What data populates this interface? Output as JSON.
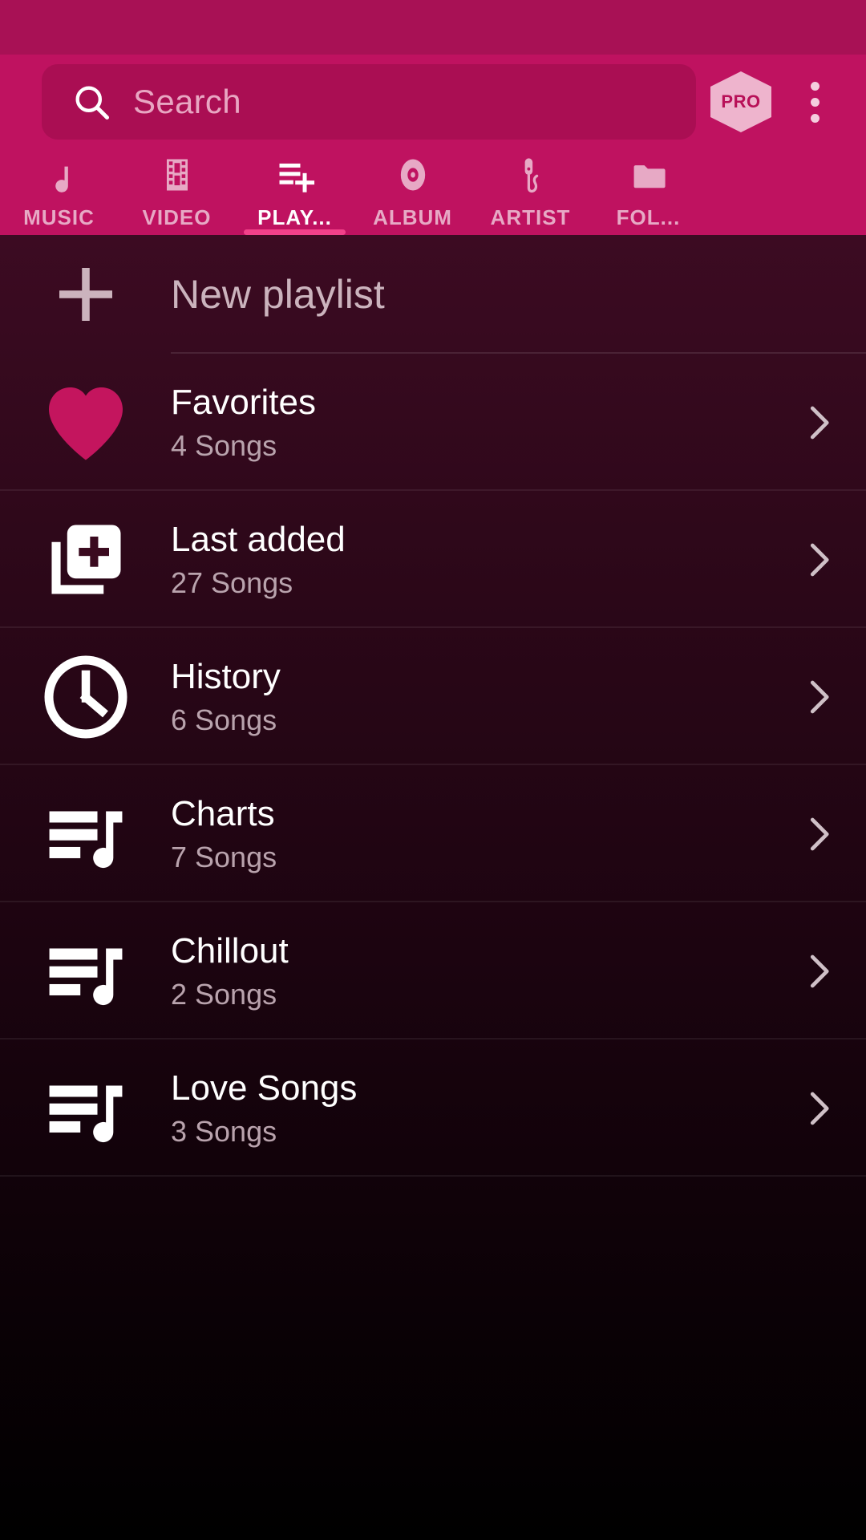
{
  "statusbar": {
    "color": "#a81155"
  },
  "appbar": {
    "color": "#bf1260",
    "search": {
      "placeholder": "Search",
      "value": "",
      "icon": "search-icon"
    },
    "pro_badge": {
      "label": "PRO",
      "hex_color": "#eeb4cd",
      "text_color": "#b81058"
    },
    "overflow": {
      "icon": "more-vertical-icon"
    }
  },
  "tabs": {
    "active_index": 2,
    "active_indicator_color": "#f2418a",
    "items": [
      {
        "label": "MUSIC",
        "icon": "music-note-icon"
      },
      {
        "label": "VIDEO",
        "icon": "film-strip-icon"
      },
      {
        "label": "PLAY...",
        "icon": "playlist-add-icon"
      },
      {
        "label": "ALBUM",
        "icon": "vinyl-disc-icon"
      },
      {
        "label": "ARTIST",
        "icon": "microphone-icon"
      },
      {
        "label": "FOL...",
        "icon": "folder-icon"
      }
    ]
  },
  "content": {
    "new_playlist": {
      "label": "New playlist",
      "icon": "plus-icon"
    },
    "playlists": [
      {
        "title": "Favorites",
        "subtitle": "4 Songs",
        "icon": "heart-icon",
        "icon_color": "#c4155e",
        "chevron": "chevron-right-icon"
      },
      {
        "title": "Last added",
        "subtitle": "27 Songs",
        "icon": "library-add-icon",
        "icon_color": "#ffffff",
        "chevron": "chevron-right-icon"
      },
      {
        "title": "History",
        "subtitle": "6 Songs",
        "icon": "clock-icon",
        "icon_color": "#ffffff",
        "chevron": "chevron-right-icon"
      },
      {
        "title": "Charts",
        "subtitle": "7 Songs",
        "icon": "queue-music-icon",
        "icon_color": "#ffffff",
        "chevron": "chevron-right-icon"
      },
      {
        "title": "Chillout",
        "subtitle": "2 Songs",
        "icon": "queue-music-icon",
        "icon_color": "#ffffff",
        "chevron": "chevron-right-icon"
      },
      {
        "title": "Love Songs",
        "subtitle": "3 Songs",
        "icon": "queue-music-icon",
        "icon_color": "#ffffff",
        "chevron": "chevron-right-icon"
      }
    ]
  }
}
